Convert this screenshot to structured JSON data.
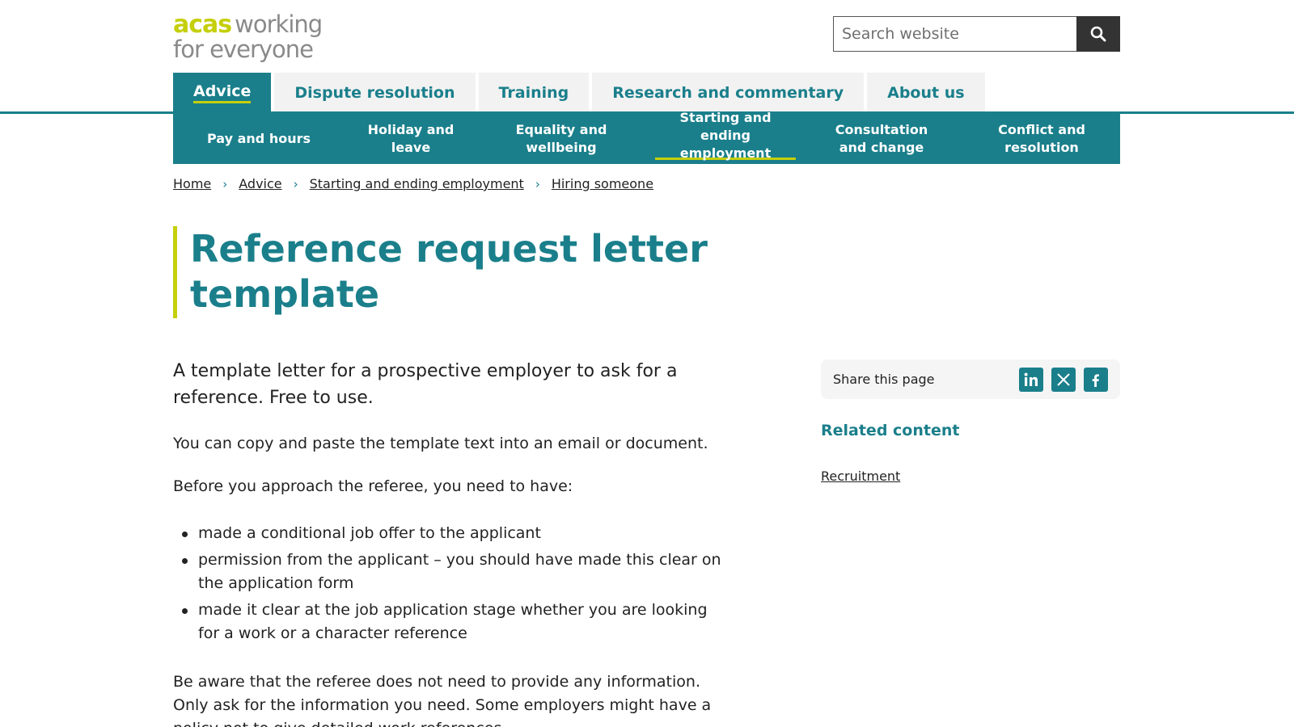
{
  "header": {
    "logo": {
      "brand": "acas",
      "tagline_1": "working",
      "tagline_2": "for everyone"
    },
    "search": {
      "placeholder": "Search website",
      "button_icon": "search-icon"
    }
  },
  "main_nav": {
    "tabs": [
      {
        "label": "Advice",
        "active": true
      },
      {
        "label": "Dispute resolution",
        "active": false
      },
      {
        "label": "Training",
        "active": false
      },
      {
        "label": "Research and commentary",
        "active": false
      },
      {
        "label": "About us",
        "active": false
      }
    ]
  },
  "sub_nav": {
    "items": [
      {
        "label": "Pay and hours",
        "active": false
      },
      {
        "label": "Holiday and leave",
        "active": false
      },
      {
        "label": "Equality and wellbeing",
        "active": false
      },
      {
        "label": "Starting and ending employment",
        "active": true
      },
      {
        "label": "Consultation and change",
        "active": false
      },
      {
        "label": "Conflict and resolution",
        "active": false
      }
    ]
  },
  "breadcrumb": [
    "Home",
    "Advice",
    "Starting and ending employment",
    "Hiring someone"
  ],
  "page": {
    "title": "Reference request letter template",
    "lead": "A template letter for a prospective employer to ask for a reference. Free to use.",
    "para1": "You can copy and paste the template text into an email or document.",
    "para2": "Before you approach the referee, you need to have:",
    "bullets": [
      "made a conditional job offer to the applicant",
      "permission from the applicant – you should have made this clear on the application form",
      "made it clear at the job application stage whether you are looking for a work or a character reference"
    ],
    "para3": "Be aware that the referee does not need to provide any information. Only ask for the information you need. Some employers might have a policy not to give detailed work references."
  },
  "sidebar": {
    "share_label": "Share this page",
    "share_icons": [
      "linkedin-icon",
      "x-icon",
      "facebook-icon"
    ],
    "related_heading": "Related content",
    "related_links": [
      "Recruitment"
    ]
  },
  "colors": {
    "teal": "#1a7f8b",
    "lime": "#c5cf0a",
    "grey": "#8a8a8a",
    "dark": "#333333"
  }
}
